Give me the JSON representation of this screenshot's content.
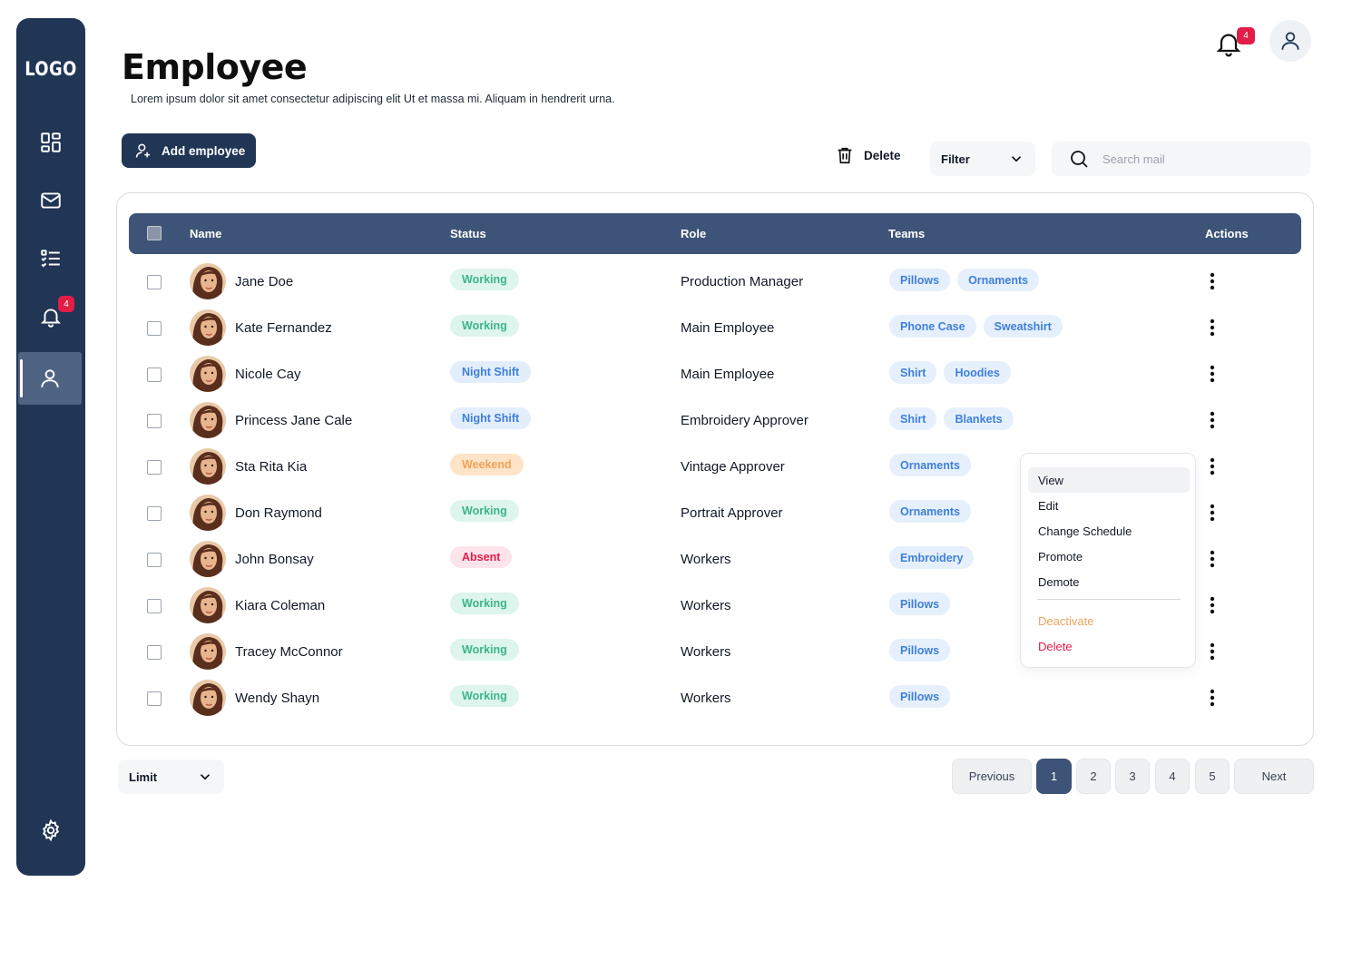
{
  "sidebar": {
    "logo": "LOGO",
    "notification_badge": "4",
    "items": [
      {
        "icon": "dashboard-icon"
      },
      {
        "icon": "mail-icon"
      },
      {
        "icon": "tasks-icon"
      },
      {
        "icon": "bell-icon"
      },
      {
        "icon": "user-icon",
        "active": true
      },
      {
        "icon": "gear-icon"
      }
    ]
  },
  "header": {
    "title": "Employee",
    "subtitle": "Lorem ipsum dolor sit amet consectetur adipiscing elit Ut et massa mi. Aliquam in hendrerit urna.",
    "notification_badge": "4"
  },
  "toolbar": {
    "add_label": "Add employee",
    "delete_label": "Delete",
    "filter_label": "Filter",
    "search_placeholder": "Search mail"
  },
  "table": {
    "columns": [
      "Name",
      "Status",
      "Role",
      "Teams",
      "Actions"
    ],
    "rows": [
      {
        "name": "Jane Doe",
        "status": "Working",
        "status_type": "working",
        "role": "Production Manager",
        "teams": [
          "Pillows",
          "Ornaments"
        ]
      },
      {
        "name": "Kate Fernandez",
        "status": "Working",
        "status_type": "working",
        "role": "Main Employee",
        "teams": [
          "Phone Case",
          "Sweatshirt"
        ]
      },
      {
        "name": "Nicole Cay",
        "status": "Night Shift",
        "status_type": "night",
        "role": "Main Employee",
        "teams": [
          "Shirt",
          "Hoodies"
        ]
      },
      {
        "name": "Princess Jane Cale",
        "status": "Night Shift",
        "status_type": "night",
        "role": "Embroidery Approver",
        "teams": [
          "Shirt",
          "Blankets"
        ]
      },
      {
        "name": "Sta Rita Kia",
        "status": "Weekend",
        "status_type": "weekend",
        "role": "Vintage Approver",
        "teams": [
          "Ornaments"
        ]
      },
      {
        "name": "Don Raymond",
        "status": "Working",
        "status_type": "working",
        "role": "Portrait Approver",
        "teams": [
          "Ornaments"
        ]
      },
      {
        "name": "John Bonsay",
        "status": "Absent",
        "status_type": "absent",
        "role": "Workers",
        "teams": [
          "Embroidery"
        ]
      },
      {
        "name": "Kiara Coleman",
        "status": "Working",
        "status_type": "working",
        "role": "Workers",
        "teams": [
          "Pillows"
        ]
      },
      {
        "name": "Tracey McConnor",
        "status": "Working",
        "status_type": "working",
        "role": "Workers",
        "teams": [
          "Pillows"
        ]
      },
      {
        "name": "Wendy Shayn",
        "status": "Working",
        "status_type": "working",
        "role": "Workers",
        "teams": [
          "Pillows"
        ]
      }
    ]
  },
  "action_menu": {
    "items": [
      "View",
      "Edit",
      "Change Schedule",
      "Promote",
      "Demote"
    ],
    "deactivate": "Deactivate",
    "delete": "Delete"
  },
  "pagination": {
    "limit_label": "Limit",
    "previous": "Previous",
    "next": "Next",
    "pages": [
      "1",
      "2",
      "3",
      "4",
      "5"
    ],
    "current": "1"
  },
  "colors": {
    "sidebar": "#213555",
    "table_header": "#3D5478",
    "badge": "#E11D48",
    "deactivate": "#F0A35B"
  }
}
